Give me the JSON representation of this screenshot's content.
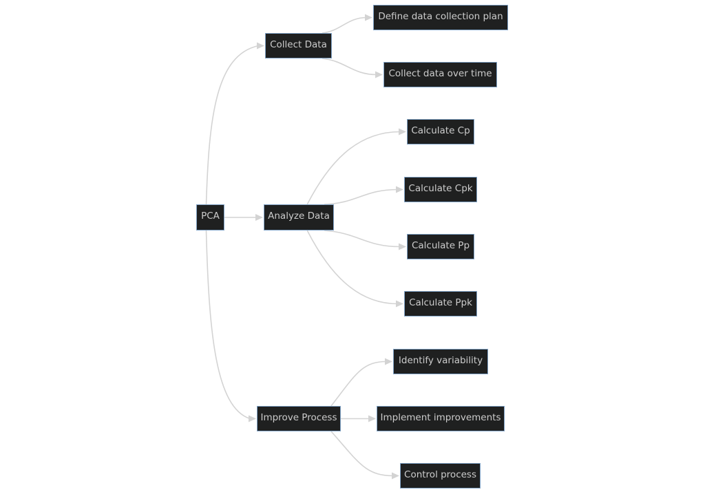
{
  "diagram": {
    "type": "flowchart-lr",
    "colors": {
      "node_fill": "#1f2020",
      "node_border": "#81a4c8",
      "node_text": "#cccccc",
      "edge": "#d3d3d3",
      "background": "#ffffff"
    },
    "nodes": {
      "pca": "PCA",
      "collect_data": "Collect Data",
      "analyze_data": "Analyze Data",
      "improve_process": "Improve Process",
      "define_plan": "Define data collection plan",
      "collect_over_time": "Collect data over time",
      "calc_cp": "Calculate Cp",
      "calc_cpk": "Calculate Cpk",
      "calc_pp": "Calculate Pp",
      "calc_ppk": "Calculate Ppk",
      "identify_variability": "Identify variability",
      "implement_improvements": "Implement improvements",
      "control_process": "Control process"
    },
    "edges": [
      {
        "from": "pca",
        "to": "collect_data"
      },
      {
        "from": "pca",
        "to": "analyze_data"
      },
      {
        "from": "pca",
        "to": "improve_process"
      },
      {
        "from": "collect_data",
        "to": "define_plan"
      },
      {
        "from": "collect_data",
        "to": "collect_over_time"
      },
      {
        "from": "analyze_data",
        "to": "calc_cp"
      },
      {
        "from": "analyze_data",
        "to": "calc_cpk"
      },
      {
        "from": "analyze_data",
        "to": "calc_pp"
      },
      {
        "from": "analyze_data",
        "to": "calc_ppk"
      },
      {
        "from": "improve_process",
        "to": "identify_variability"
      },
      {
        "from": "improve_process",
        "to": "implement_improvements"
      },
      {
        "from": "improve_process",
        "to": "control_process"
      }
    ]
  }
}
